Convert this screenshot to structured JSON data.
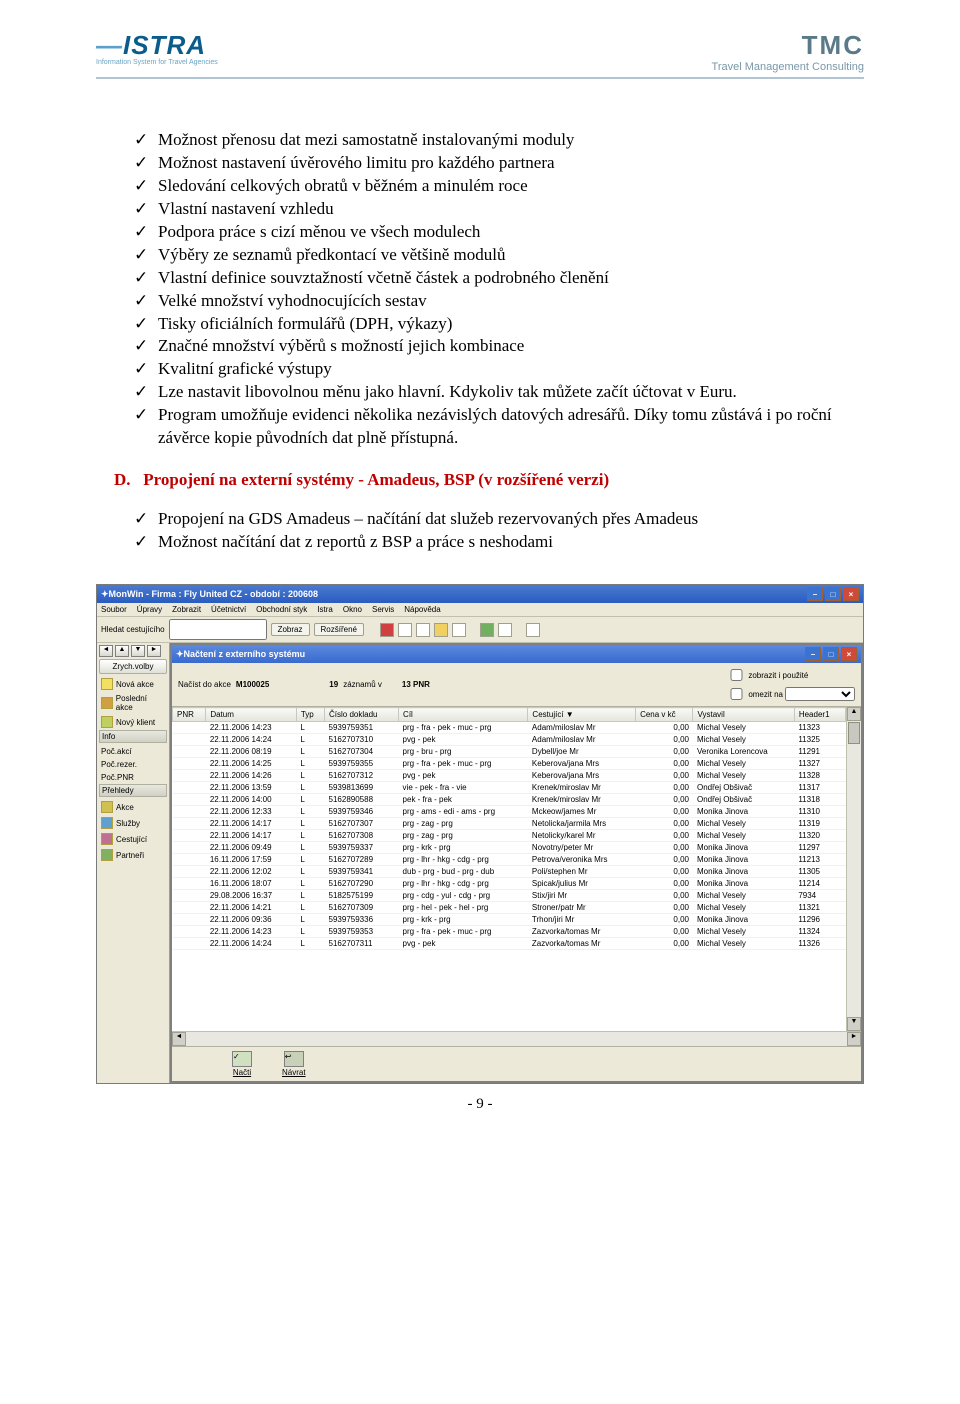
{
  "header": {
    "left_brand": "ISTRA",
    "left_sub": "Information System for Travel Agencies",
    "right_brand": "TMC",
    "right_sub": "Travel Management Consulting"
  },
  "bullets1": [
    "Možnost přenosu dat mezi samostatně instalovanými moduly",
    "Možnost nastavení úvěrového limitu pro každého partnera",
    "Sledování celkových obratů v běžném a minulém roce",
    "Vlastní nastavení vzhledu",
    "Podpora práce s cizí měnou ve všech modulech",
    "Výběry ze seznamů předkontací ve většině modulů",
    "Vlastní definice souvztažností včetně částek a podrobného členění",
    "Velké množství vyhodnocujících sestav",
    "Tisky oficiálních formulářů (DPH, výkazy)",
    "Značné množství výběrů s možností jejich kombinace",
    "Kvalitní grafické výstupy",
    "Lze nastavit libovolnou měnu jako hlavní. Kdykoliv tak můžete začít účtovat v Euru.",
    "Program umožňuje evidenci několika nezávislých datových adresářů. Díky tomu zůstává i po roční závěrce kopie původních dat plně přístupná."
  ],
  "section_d": {
    "label": "D.",
    "title": "Propojení na externí systémy - Amadeus, BSP (v rozšířené verzi)"
  },
  "bullets2": [
    "Propojení na GDS Amadeus – načítání dat služeb rezervovaných přes Amadeus",
    "Možnost načítání dat z reportů z BSP a práce s neshodami"
  ],
  "app": {
    "title": "MonWin - Firma : Fly United CZ - období : 200608",
    "menu": [
      "Soubor",
      "Úpravy",
      "Zobrazit",
      "Účetnictví",
      "Obchodní styk",
      "Istra",
      "Okno",
      "Servis",
      "Nápověda"
    ],
    "toolbar": {
      "search_label": "Hledat cestujícího",
      "btn_zobraz": "Zobraz",
      "btn_rozsirene": "Rozšířené"
    },
    "subtitle": "Načtení z externího systému",
    "loadbar": {
      "l1": "Načíst do akce",
      "akce": "M100025",
      "count": "19",
      "l2": "záznamů v",
      "pnr": "13 PNR",
      "chk1": "zobrazit i použité",
      "chk2": "omezit na"
    },
    "sidebar": {
      "zrych": "Zrych.volby",
      "novaakce": "Nová akce",
      "posledni": "Poslední akce",
      "novyklient": "Nový klient",
      "info": "Info",
      "pocakci": "Poč.akcí",
      "pocrezer": "Poč.rezer.",
      "pocpnr": "Poč.PNR",
      "prehledy": "Přehledy",
      "akce": "Akce",
      "sluzby": "Služby",
      "cestujici": "Cestující",
      "partneri": "Partneři"
    },
    "headers": [
      "PNR",
      "Datum",
      "Typ",
      "Číslo dokladu",
      "Cíl",
      "Cestující ▼",
      "Cena v kč",
      "Vystavil",
      "Header1"
    ],
    "rows": [
      [
        "",
        "22.11.2006 14:23",
        "L",
        "5939759351",
        "prg - fra - pek - muc - prg",
        "Adam/miloslav Mr",
        "0,00",
        "Michal Vesely",
        "11323"
      ],
      [
        "",
        "22.11.2006 14:24",
        "L",
        "5162707310",
        "pvg - pek",
        "Adam/miloslav Mr",
        "0,00",
        "Michal Vesely",
        "11325"
      ],
      [
        "",
        "22.11.2006 08:19",
        "L",
        "5162707304",
        "prg - bru - prg",
        "Dybell/joe Mr",
        "0,00",
        "Veronika Lorencova",
        "11291"
      ],
      [
        "",
        "22.11.2006 14:25",
        "L",
        "5939759355",
        "prg - fra - pek - muc - prg",
        "Keberova/jana Mrs",
        "0,00",
        "Michal Vesely",
        "11327"
      ],
      [
        "",
        "22.11.2006 14:26",
        "L",
        "5162707312",
        "pvg - pek",
        "Keberova/jana Mrs",
        "0,00",
        "Michal Vesely",
        "11328"
      ],
      [
        "",
        "22.11.2006 13:59",
        "L",
        "5939813699",
        "vie - pek - fra - vie",
        "Krenek/miroslav Mr",
        "0,00",
        "Ondřej Obšivač",
        "11317"
      ],
      [
        "",
        "22.11.2006 14:00",
        "L",
        "5162890588",
        "pek - fra - pek",
        "Krenek/miroslav Mr",
        "0,00",
        "Ondřej Obšivač",
        "11318"
      ],
      [
        "",
        "22.11.2006 12:33",
        "L",
        "5939759346",
        "prg - ams - edi - ams - prg",
        "Mckeow/james Mr",
        "0,00",
        "Monika Jinova",
        "11310"
      ],
      [
        "",
        "22.11.2006 14:17",
        "L",
        "5162707307",
        "prg - zag - prg",
        "Netolicka/jarmila Mrs",
        "0,00",
        "Michal Vesely",
        "11319"
      ],
      [
        "",
        "22.11.2006 14:17",
        "L",
        "5162707308",
        "prg - zag - prg",
        "Netolicky/karel Mr",
        "0,00",
        "Michal Vesely",
        "11320"
      ],
      [
        "",
        "22.11.2006 09:49",
        "L",
        "5939759337",
        "prg - krk - prg",
        "Novotny/peter Mr",
        "0,00",
        "Monika Jinova",
        "11297"
      ],
      [
        "",
        "16.11.2006 17:59",
        "L",
        "5162707289",
        "prg - lhr - hkg - cdg - prg",
        "Petrova/veronika Mrs",
        "0,00",
        "Monika Jinova",
        "11213"
      ],
      [
        "",
        "22.11.2006 12:02",
        "L",
        "5939759341",
        "dub - prg - bud - prg - dub",
        "Poli/stephen Mr",
        "0,00",
        "Monika Jinova",
        "11305"
      ],
      [
        "",
        "16.11.2006 18:07",
        "L",
        "5162707290",
        "prg - lhr - hkg - cdg - prg",
        "Spicak/julius Mr",
        "0,00",
        "Monika Jinova",
        "11214"
      ],
      [
        "",
        "29.08.2006 16:37",
        "L",
        "5182575199",
        "prg - cdg - yul - cdg - prg",
        "Stix/jiri Mr",
        "0,00",
        "Michal Vesely",
        "7934"
      ],
      [
        "",
        "22.11.2006 14:21",
        "L",
        "5162707309",
        "prg - hel - pek - hel - prg",
        "Stroner/patr Mr",
        "0,00",
        "Michal Vesely",
        "11321"
      ],
      [
        "",
        "22.11.2006 09:36",
        "L",
        "5939759336",
        "prg - krk - prg",
        "Trhon/jiri Mr",
        "0,00",
        "Monika Jinova",
        "11296"
      ],
      [
        "",
        "22.11.2006 14:23",
        "L",
        "5939759353",
        "prg - fra - pek - muc - prg",
        "Zazvorka/tomas Mr",
        "0,00",
        "Michal Vesely",
        "11324"
      ],
      [
        "",
        "22.11.2006 14:24",
        "L",
        "5162707311",
        "pvg - pek",
        "Zazvorka/tomas Mr",
        "0,00",
        "Michal Vesely",
        "11326"
      ]
    ],
    "footer": {
      "nacti": "Načti",
      "navrat": "Návrat"
    }
  },
  "pagenum": "- 9 -"
}
